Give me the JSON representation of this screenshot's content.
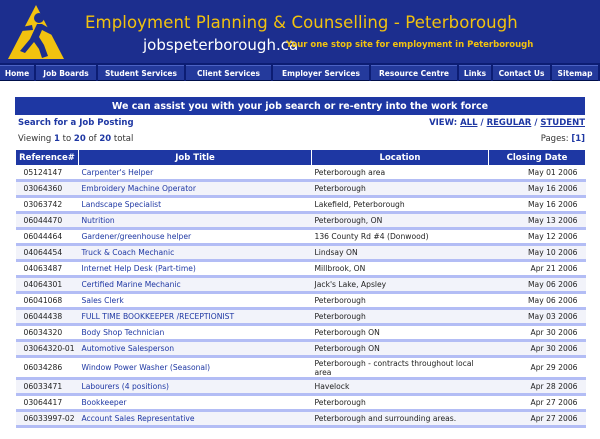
{
  "header": {
    "title": "Employment Planning & Counselling - Peterborough",
    "domain": "jobspeterborough.ca",
    "tagline": "Your one stop site for employment in Peterborough"
  },
  "nav": [
    {
      "label": "Home"
    },
    {
      "label": "Job Boards"
    },
    {
      "label": "Student Services"
    },
    {
      "label": "Client Services"
    },
    {
      "label": "Employer Services"
    },
    {
      "label": "Resource Centre"
    },
    {
      "label": "Links"
    },
    {
      "label": "Contact Us"
    },
    {
      "label": "Sitemap"
    }
  ],
  "banner": "We can assist you with your job search or re-entry into the work force",
  "search_link": "Search for a Job Posting",
  "view": {
    "label": "VIEW:",
    "all": "ALL",
    "sep": "/",
    "regular": "REGULAR",
    "student": "STUDENT"
  },
  "viewing": {
    "prefix": "Viewing",
    "from": "1",
    "to_word": "to",
    "to": "20",
    "of_word": "of",
    "total": "20",
    "suffix": "total"
  },
  "pages": {
    "label": "Pages:",
    "current": "[1]"
  },
  "table": {
    "headers": [
      "Reference#",
      "Job Title",
      "Location",
      "Closing Date"
    ],
    "rows": [
      {
        "ref": "05124147",
        "title": "Carpenter's Helper",
        "location": "Peterborough area",
        "date": "May 01 2006"
      },
      {
        "ref": "03064360",
        "title": "Embroidery Machine Operator",
        "location": "Peterborough",
        "date": "May 16 2006"
      },
      {
        "ref": "03063742",
        "title": "Landscape Specialist",
        "location": "Lakefield, Peterborough",
        "date": "May 16 2006"
      },
      {
        "ref": "06044470",
        "title": "Nutrition",
        "location": "Peterborough, ON",
        "date": "May 13 2006"
      },
      {
        "ref": "06044464",
        "title": "Gardener/greenhouse helper",
        "location": "136 County Rd #4 (Donwood)",
        "date": "May 12 2006"
      },
      {
        "ref": "04064454",
        "title": "Truck & Coach Mechanic",
        "location": "Lindsay ON",
        "date": "May 10 2006"
      },
      {
        "ref": "04063487",
        "title": "Internet Help Desk (Part-time)",
        "location": "Millbrook, ON",
        "date": "Apr 21 2006"
      },
      {
        "ref": "04064301",
        "title": "Certified Marine Mechanic",
        "location": "Jack's Lake, Apsley",
        "date": "May 06 2006"
      },
      {
        "ref": "06041068",
        "title": "Sales Clerk",
        "location": "Peterborough",
        "date": "May 06 2006"
      },
      {
        "ref": "06044438",
        "title": "FULL TIME BOOKKEEPER /RECEPTIONIST",
        "location": "Peterborough",
        "date": "May 03 2006"
      },
      {
        "ref": "06034320",
        "title": "Body Shop Technician",
        "location": "Peterborough ON",
        "date": "Apr 30 2006"
      },
      {
        "ref": "03064320-01",
        "title": "Automotive Salesperson",
        "location": "Peterborough ON",
        "date": "Apr 30 2006"
      },
      {
        "ref": "06034286",
        "title": "Window Power Washer (Seasonal)",
        "location": "Peterborough - contracts throughout local area",
        "date": "Apr 29 2006"
      },
      {
        "ref": "06033471",
        "title": "Labourers (4 positions)",
        "location": "Havelock",
        "date": "Apr 28 2006"
      },
      {
        "ref": "03064417",
        "title": "Bookkeeper",
        "location": "Peterborough",
        "date": "Apr 27 2006"
      },
      {
        "ref": "06033997-02",
        "title": "Account Sales Representative",
        "location": "Peterborough and surrounding areas.",
        "date": "Apr 27 2006"
      }
    ]
  },
  "colors": {
    "header_bg": "#1c2e8e",
    "accent_yellow": "#f2c20f",
    "nav_bg": "#0c1d73",
    "table_header": "#1e37a3",
    "row_divider": "#b3bdf5"
  }
}
